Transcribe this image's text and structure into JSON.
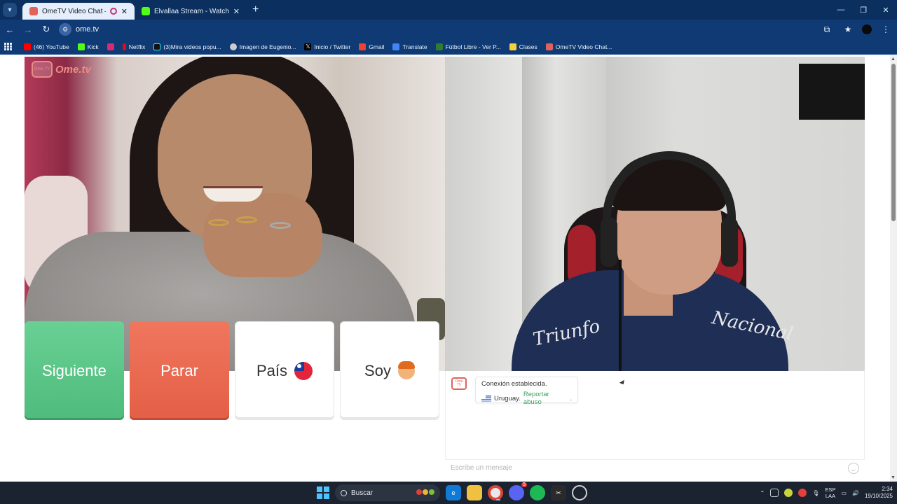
{
  "browser": {
    "tabs": [
      {
        "title": "OmeTV Video Chat — Ome",
        "active": true
      },
      {
        "title": "Elvallaa Stream - Watch Live on",
        "active": false
      }
    ],
    "url": "ome.tv",
    "bookmarks": [
      {
        "label": "(46) YouTube",
        "color": "#ff0000"
      },
      {
        "label": "Kick",
        "color": "#53fc18"
      },
      {
        "label": "",
        "color": "#d62976"
      },
      {
        "label": "Netflix",
        "color": "#e50914"
      },
      {
        "label": "(3)Mira videos popu...",
        "color": "#111111"
      },
      {
        "label": "Imagen de Eugenio...",
        "color": "#cccccc"
      },
      {
        "label": "Inicio / Twitter",
        "color": "#000000"
      },
      {
        "label": "Gmail",
        "color": "#ea4335"
      },
      {
        "label": "Translate",
        "color": "#4285f4"
      },
      {
        "label": "Fútbol Libre - Ver P...",
        "color": "#2e7d32"
      },
      {
        "label": "Clases",
        "color": "#f4d03f"
      },
      {
        "label": "OmeTV Video Chat...",
        "color": "#e0625b"
      }
    ]
  },
  "brand": {
    "logo_small": "Ome TV",
    "name": "Ome.tv"
  },
  "stranger_shirt_text": [
    "Triunfo",
    "Nacional"
  ],
  "controls": {
    "next_label": "Siguiente",
    "stop_label": "Parar",
    "country_label": "País",
    "gender_label": "Soy"
  },
  "chat": {
    "logo": "Ome TV",
    "status": "Conexión establecida.",
    "country": "Uruguay.",
    "report": "Reportar abuso",
    "report_suffix": ".",
    "placeholder": "Escribe un mensaje"
  },
  "taskbar": {
    "search_label": "Buscar",
    "lang_top": "ESP",
    "lang_bottom": "LAA",
    "time": "2:34",
    "date": "19/10/2025",
    "discord_badge": "5"
  },
  "colors": {
    "next": "#5cc688",
    "stop": "#e86a51",
    "accent_green": "#3aa05c",
    "brand": "#e98b86"
  }
}
